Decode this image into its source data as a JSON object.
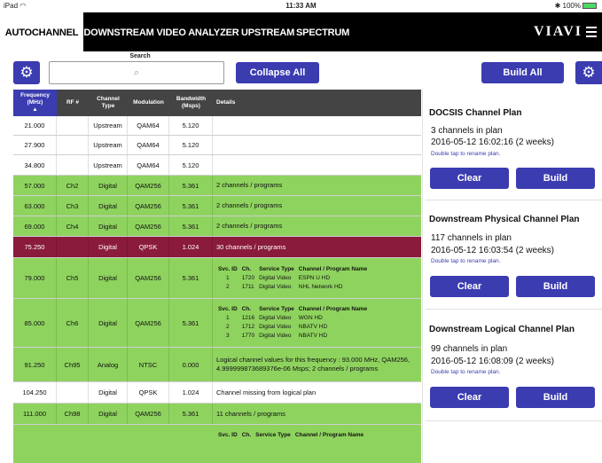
{
  "status_bar": {
    "device": "iPad",
    "wifi": "◠",
    "time": "11:33 AM",
    "bluetooth": "✱",
    "battery": "100%"
  },
  "tabs": [
    {
      "label": "AUTOCHANNEL",
      "active": true
    },
    {
      "label": "DOWNSTREAM",
      "active": false
    },
    {
      "label": "VIDEO ANALYZER",
      "active": false
    },
    {
      "label": "UPSTREAM",
      "active": false
    },
    {
      "label": "SPECTRUM",
      "active": false
    }
  ],
  "brand": "VIAVI",
  "toolbar": {
    "search_label": "Search",
    "search_placeholder": "",
    "collapse_all": "Collapse All",
    "build_all": "Build All",
    "gear_glyph": "⚙",
    "search_glyph": "⌕"
  },
  "table": {
    "sort_glyph": "▲",
    "headers": [
      "Frequency (MHz)",
      "RF #",
      "Channel Type",
      "Modulation",
      "Bandwidth (Msps)",
      "Details"
    ],
    "rows": [
      {
        "freq": "21.000",
        "rf": "",
        "type": "Upstream",
        "mod": "QAM64",
        "bw": "5.120",
        "details": ""
      },
      {
        "freq": "27.900",
        "rf": "",
        "type": "Upstream",
        "mod": "QAM64",
        "bw": "5.120",
        "details": ""
      },
      {
        "freq": "34.800",
        "rf": "",
        "type": "Upstream",
        "mod": "QAM64",
        "bw": "5.120",
        "details": ""
      },
      {
        "freq": "57.000",
        "rf": "Ch2",
        "type": "Digital",
        "mod": "QAM256",
        "bw": "5.361",
        "details": "2 channels / programs"
      },
      {
        "freq": "63.000",
        "rf": "Ch3",
        "type": "Digital",
        "mod": "QAM256",
        "bw": "5.361",
        "details": "2 channels / programs"
      },
      {
        "freq": "69.000",
        "rf": "Ch4",
        "type": "Digital",
        "mod": "QAM256",
        "bw": "5.361",
        "details": "2 channels / programs"
      },
      {
        "freq": "75.250",
        "rf": "",
        "type": "Digital",
        "mod": "QPSK",
        "bw": "1.024",
        "details": "30 channels / programs"
      },
      {
        "freq": "79.000",
        "rf": "Ch5",
        "type": "Digital",
        "mod": "QAM256",
        "bw": "5.361",
        "details": ""
      },
      {
        "freq": "85.000",
        "rf": "Ch6",
        "type": "Digital",
        "mod": "QAM256",
        "bw": "5.361",
        "details": ""
      },
      {
        "freq": "91.250",
        "rf": "Ch95",
        "type": "Analog",
        "mod": "NTSC",
        "bw": "0.000",
        "details": "Logical channel values for this frequency : 93.000 MHz, QAM256, 4.999999873689376e-06 Msps; 2 channels / programs"
      },
      {
        "freq": "104.250",
        "rf": "",
        "type": "Digital",
        "mod": "QPSK",
        "bw": "1.024",
        "details": "Channel missing from logical plan"
      },
      {
        "freq": "111.000",
        "rf": "Ch98",
        "type": "Digital",
        "mod": "QAM256",
        "bw": "5.361",
        "details": "11 channels / programs"
      }
    ],
    "svc_headers": [
      "Svc. ID",
      "Ch.",
      "Service Type",
      "Channel / Program Name"
    ],
    "svc_79": [
      [
        "1",
        "1720",
        "Digital Video",
        "ESPN U HD"
      ],
      [
        "2",
        "1711",
        "Digital Video",
        "NHL Network HD"
      ]
    ],
    "svc_85": [
      [
        "1",
        "1216",
        "Digital Video",
        "WGN HD"
      ],
      [
        "2",
        "1712",
        "Digital Video",
        "NBATV HD"
      ],
      [
        "3",
        "1770",
        "Digital Video",
        "NBATV HD"
      ]
    ]
  },
  "plans": [
    {
      "title": "DOCSIS Channel Plan",
      "count": "3 channels in plan",
      "date": "2016-05-12 16:02:16 (2 weeks)",
      "hint": "Double tap to rename plan.",
      "clear": "Clear",
      "build": "Build"
    },
    {
      "title": "Downstream Physical Channel Plan",
      "count": "117 channels in plan",
      "date": "2016-05-12 16:03:54 (2 weeks)",
      "hint": "Double tap to rename plan.",
      "clear": "Clear",
      "build": "Build"
    },
    {
      "title": "Downstream Logical Channel Plan",
      "count": "99 channels in plan",
      "date": "2016-05-12 16:08:09 (2 weeks)",
      "hint": "Double tap to rename plan.",
      "clear": "Clear",
      "build": "Build"
    }
  ],
  "colors": {
    "accent": "#3b3cb0",
    "row_green": "#8fd35f",
    "row_red": "#8a1b3b",
    "header_bg": "#444444"
  }
}
